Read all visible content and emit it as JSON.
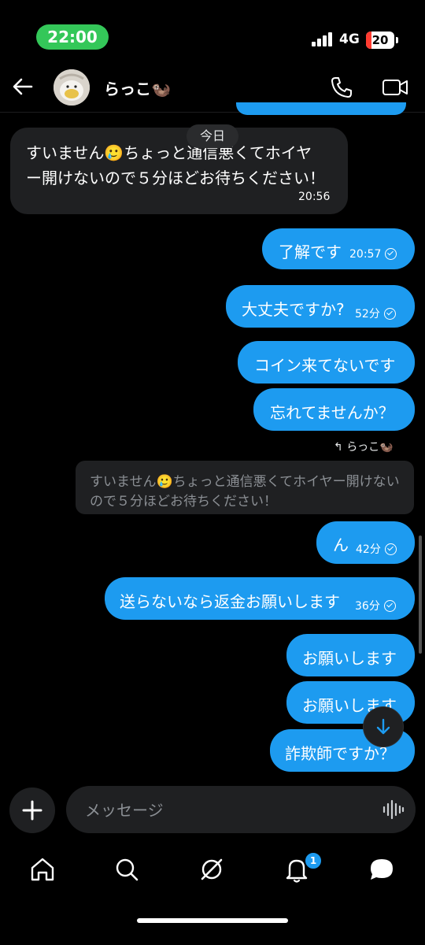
{
  "status_bar": {
    "time": "22:00",
    "network": "4G",
    "battery": "20",
    "battery_level": 0.2
  },
  "header": {
    "contact_name": "らっこ🦦",
    "back_icon": "arrow-left-icon",
    "call_icon": "phone-icon",
    "video_icon": "video-camera-icon"
  },
  "date_separator": "今日",
  "messages": [
    {
      "dir": "in",
      "lines": [
        "すいません🥲ちょっと通信悪くてホイヤ",
        "ー開けないので５分ほどお待ちください！"
      ],
      "time": "20:56"
    },
    {
      "dir": "out",
      "text": "了解です",
      "time": "20:57",
      "read": true
    },
    {
      "dir": "out",
      "text": "大丈夫ですか?",
      "time": "52分",
      "read": true
    },
    {
      "dir": "out",
      "text": "コイン来てないです"
    },
    {
      "dir": "out",
      "text": "忘れてませんか？"
    },
    {
      "dir": "out",
      "text": "ん",
      "time": "42分",
      "read": true
    },
    {
      "dir": "out",
      "text": "送らないなら返金お願いします",
      "time": "36分",
      "read": true
    },
    {
      "dir": "out",
      "text": "お願いします"
    },
    {
      "dir": "out",
      "text": "お願いします"
    },
    {
      "dir": "out",
      "text": "詐欺師ですか？"
    }
  ],
  "reply": {
    "context": "らっこ🦦",
    "quote_lines": [
      "すいません🥲ちょっと通信悪くてホイヤー開けない",
      "ので５分ほどお待ちください！"
    ]
  },
  "composer": {
    "placeholder": "メッセージ"
  },
  "nav": {
    "items": [
      "home-icon",
      "search-icon",
      "grok-icon",
      "bell-icon",
      "messages-icon"
    ],
    "notification_count": "1"
  },
  "colors": {
    "bubble_out": "#1d9bf0",
    "bubble_in": "#1f2022",
    "background": "#000000",
    "status_time_bg": "#34c759"
  }
}
